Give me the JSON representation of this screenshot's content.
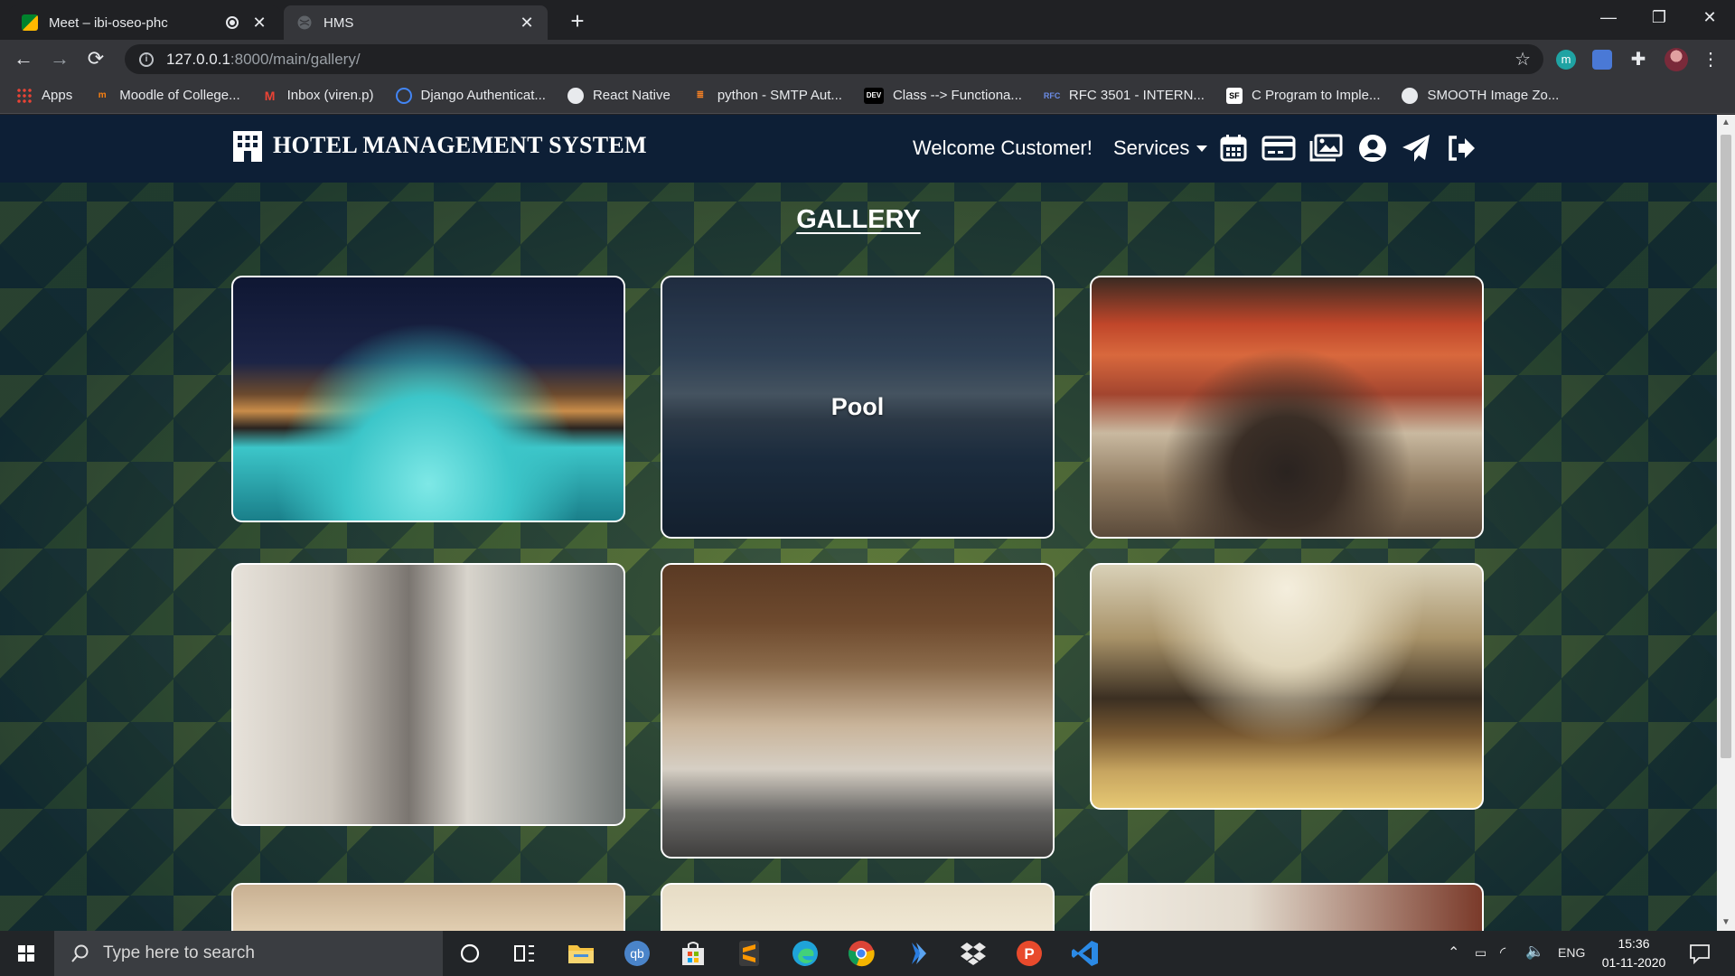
{
  "browser": {
    "tabs": [
      {
        "title": "Meet – ibi-oseo-phc",
        "active": false
      },
      {
        "title": "HMS",
        "active": true
      }
    ],
    "url_host": "127.0.0.1",
    "url_path": ":8000/main/gallery/",
    "bookmarks": [
      {
        "label": "Apps",
        "icon": "apps-grid-icon"
      },
      {
        "label": "Moodle of College...",
        "icon": "moodle-icon"
      },
      {
        "label": "Inbox (viren.p)",
        "icon": "gmail-icon"
      },
      {
        "label": "Django Authenticat...",
        "icon": "django-icon"
      },
      {
        "label": "React Native",
        "icon": "globe-icon"
      },
      {
        "label": "python - SMTP Aut...",
        "icon": "stackoverflow-icon"
      },
      {
        "label": "Class --> Functiona...",
        "icon": "dev-icon"
      },
      {
        "label": "RFC 3501 - INTERN...",
        "icon": "rfc-icon"
      },
      {
        "label": "C Program to Imple...",
        "icon": "sf-icon"
      },
      {
        "label": "SMOOTH Image Zo...",
        "icon": "globe-icon"
      }
    ]
  },
  "site": {
    "brand": "HOTEL MANAGEMENT SYSTEM",
    "welcome": "Welcome Customer!",
    "services": "Services",
    "nav_icons": [
      "calendar-icon",
      "credit-card-icon",
      "gallery-icon",
      "user-circle-icon",
      "paper-plane-icon",
      "logout-icon"
    ],
    "page_title": "GALLERY",
    "gallery": [
      {
        "caption": "",
        "image": "pool-night"
      },
      {
        "caption": "Pool",
        "image": "pool-day"
      },
      {
        "caption": "",
        "image": "banquet-hall"
      },
      {
        "caption": "",
        "image": "buffet"
      },
      {
        "caption": "",
        "image": "lounge"
      },
      {
        "caption": "",
        "image": "lobby"
      },
      {
        "caption": "",
        "image": "ceiling-room"
      },
      {
        "caption": "",
        "image": "chandelier-room"
      },
      {
        "caption": "",
        "image": "suite"
      }
    ]
  },
  "taskbar": {
    "search_placeholder": "Type here to search",
    "language": "ENG",
    "time": "15:36",
    "date": "01-11-2020"
  },
  "colors": {
    "navbar": "#0d1f36",
    "chrome_dark": "#202124",
    "chrome_mid": "#35363a"
  }
}
